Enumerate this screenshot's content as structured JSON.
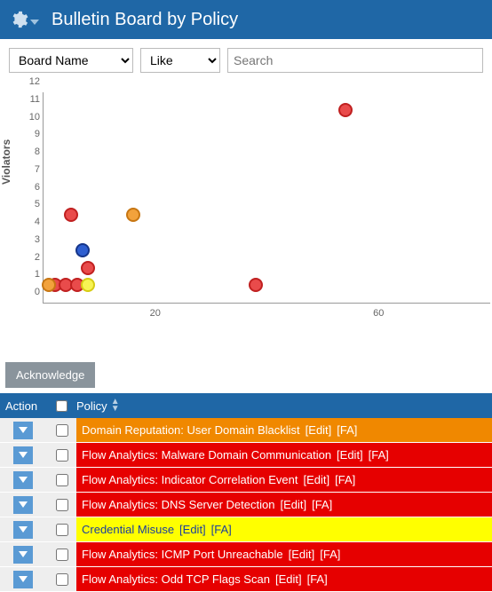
{
  "header": {
    "title": "Bulletin Board by Policy"
  },
  "filter": {
    "field_select": "Board Name",
    "op_select": "Like",
    "search_placeholder": "Search"
  },
  "chart_data": {
    "type": "scatter",
    "title": "",
    "xlabel": "",
    "ylabel": "Violators",
    "xlim": [
      0,
      80
    ],
    "ylim": [
      0,
      12
    ],
    "yticks": [
      0,
      1,
      2,
      3,
      4,
      5,
      6,
      7,
      8,
      9,
      10,
      11,
      12
    ],
    "xticks": [
      20,
      60
    ],
    "series": [
      {
        "name": "red",
        "color": "#e94b4b",
        "stroke": "#c02020",
        "points": [
          {
            "x": 2,
            "y": 1
          },
          {
            "x": 4,
            "y": 1
          },
          {
            "x": 6,
            "y": 1
          },
          {
            "x": 5,
            "y": 5
          },
          {
            "x": 8,
            "y": 2
          },
          {
            "x": 38,
            "y": 1
          },
          {
            "x": 54,
            "y": 11
          }
        ]
      },
      {
        "name": "orange",
        "color": "#f2a23c",
        "stroke": "#c77612",
        "points": [
          {
            "x": 1,
            "y": 1
          },
          {
            "x": 16,
            "y": 5
          }
        ]
      },
      {
        "name": "yellow",
        "color": "#f7f353",
        "stroke": "#d6cc13",
        "points": [
          {
            "x": 8,
            "y": 1
          }
        ]
      },
      {
        "name": "blue",
        "color": "#2f5fd0",
        "stroke": "#15358a",
        "points": [
          {
            "x": 7,
            "y": 3
          }
        ]
      }
    ]
  },
  "buttons": {
    "acknowledge": "Acknowledge"
  },
  "table": {
    "headers": {
      "action": "Action",
      "policy": "Policy"
    },
    "link_edit": "[Edit]",
    "link_fa": "[FA]",
    "rows": [
      {
        "severity": "orange",
        "policy": "Domain Reputation: User Domain Blacklist"
      },
      {
        "severity": "red",
        "policy": "Flow Analytics: Malware Domain Communication"
      },
      {
        "severity": "red",
        "policy": "Flow Analytics: Indicator Correlation Event"
      },
      {
        "severity": "red",
        "policy": "Flow Analytics: DNS Server Detection"
      },
      {
        "severity": "yellow",
        "policy": "Credential Misuse"
      },
      {
        "severity": "red",
        "policy": "Flow Analytics: ICMP Port Unreachable"
      },
      {
        "severity": "red",
        "policy": "Flow Analytics: Odd TCP Flags Scan"
      }
    ]
  }
}
